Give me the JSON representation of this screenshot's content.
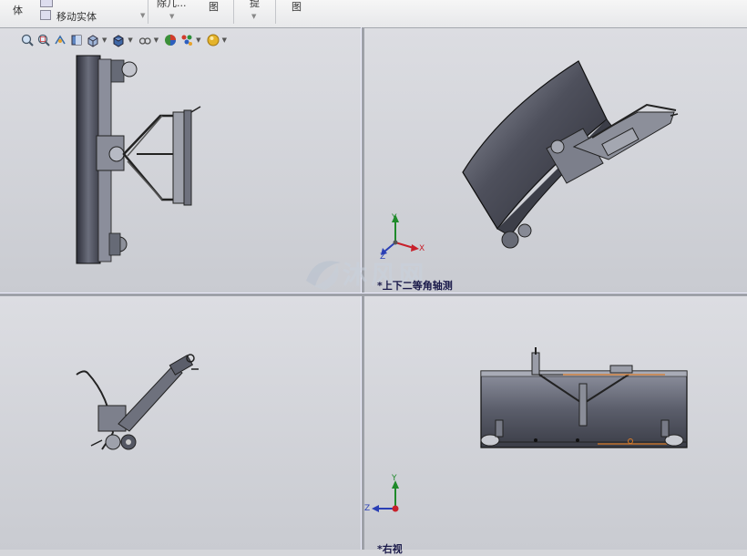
{
  "ribbon": {
    "items": [
      {
        "label": "体"
      },
      {
        "label": "移动实体"
      },
      {
        "label": "除几..."
      },
      {
        "label": "图"
      },
      {
        "label": "提"
      },
      {
        "label": "图"
      }
    ]
  },
  "view_toolbar": {
    "icons": [
      "zoom-to-fit-icon",
      "zoom-to-area-icon",
      "previous-view-icon",
      "section-view-icon",
      "view-orientation-icon",
      "display-style-icon",
      "hide-show-items-icon",
      "edit-appearance-icon",
      "apply-scene-icon",
      "view-settings-icon"
    ]
  },
  "viewports": {
    "top_right_label": "*上下二等角轴测",
    "bottom_right_label": "*右视"
  },
  "triad": {
    "x": "X",
    "y": "Y",
    "z": "Z"
  },
  "watermark": {
    "text": "沐风网"
  },
  "colors": {
    "accent_x": "#c8202b",
    "accent_y": "#1f8a2a",
    "accent_z": "#2a3fb5"
  }
}
